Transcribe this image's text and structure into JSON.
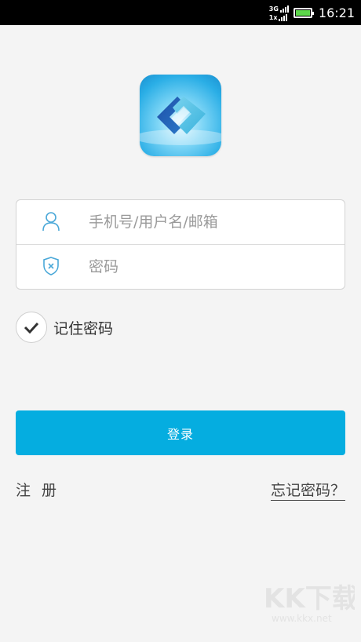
{
  "status_bar": {
    "network_top": "3G",
    "network_bottom": "1x",
    "time": "16:21",
    "battery_fraction": 1.0
  },
  "logo": {
    "icon": "app-logo-icon"
  },
  "form": {
    "username_placeholder": "手机号/用户名/邮箱",
    "password_placeholder": "密码",
    "username_icon": "user-icon",
    "password_icon": "shield-icon"
  },
  "remember": {
    "label": "记住密码",
    "checked": true
  },
  "login_button": {
    "label": "登录"
  },
  "links": {
    "register": "注册",
    "forgot": "忘记密码？"
  },
  "watermark": {
    "brand": "KK下载",
    "url": "www.kkx.net"
  },
  "colors": {
    "accent": "#05ade0",
    "background": "#f4f4f4",
    "battery": "#5cd64a"
  }
}
